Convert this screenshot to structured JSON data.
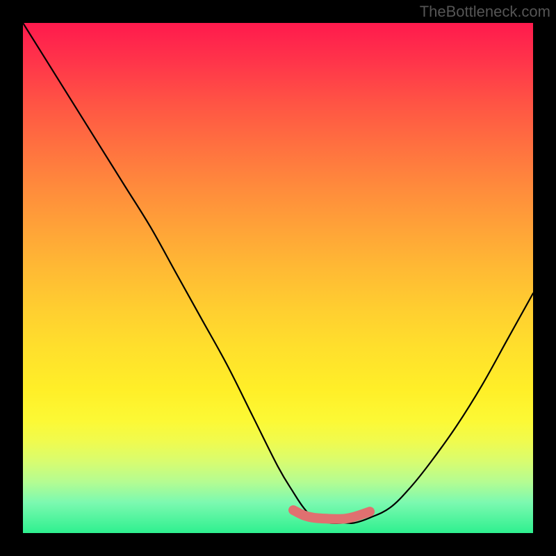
{
  "watermark": "TheBottleneck.com",
  "chart_data": {
    "type": "line",
    "title": "",
    "xlabel": "",
    "ylabel": "",
    "xlim": [
      0,
      100
    ],
    "ylim": [
      0,
      100
    ],
    "series": [
      {
        "name": "bottleneck-curve",
        "x": [
          0,
          5,
          10,
          15,
          20,
          25,
          30,
          35,
          40,
          45,
          50,
          53,
          55,
          57,
          60,
          63,
          65,
          68,
          72,
          76,
          80,
          85,
          90,
          95,
          100
        ],
        "values": [
          100,
          92,
          84,
          76,
          68,
          60,
          51,
          42,
          33,
          23,
          13,
          8,
          5,
          3,
          2,
          2,
          2,
          3,
          5,
          9,
          14,
          21,
          29,
          38,
          47
        ]
      },
      {
        "name": "optimal-zone-marker",
        "x": [
          53,
          55,
          57,
          60,
          63,
          65,
          68
        ],
        "values": [
          4.5,
          3.5,
          3,
          2.8,
          2.8,
          3.2,
          4.2
        ]
      }
    ],
    "gradient_stops": [
      {
        "pos": 0,
        "color": "#ff1a4d"
      },
      {
        "pos": 50,
        "color": "#ffce30"
      },
      {
        "pos": 80,
        "color": "#f0fb4e"
      },
      {
        "pos": 100,
        "color": "#2ef08f"
      }
    ]
  }
}
